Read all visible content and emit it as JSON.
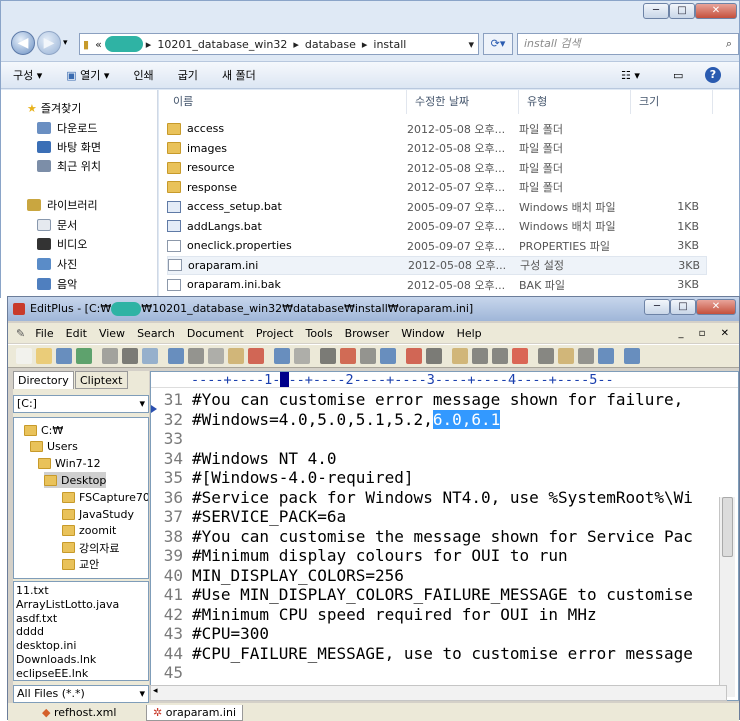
{
  "explorer": {
    "window_controls": [
      "─",
      "□",
      "✕"
    ],
    "address": {
      "back_icon": "back-arrow",
      "forward_icon": "forward-arrow",
      "prefix": "«",
      "segments": [
        "10201_database_win32",
        "database",
        "install"
      ],
      "separator": "▸"
    },
    "search": {
      "placeholder": "install 검색"
    },
    "toolbar": {
      "organize": "구성 ▾",
      "open": "열기 ▾",
      "print": "인쇄",
      "burn": "굽기",
      "new_folder": "새 폴더"
    },
    "nav": {
      "favorites": "즐겨찾기",
      "favorites_items": [
        "다운로드",
        "바탕 화면",
        "최근 위치"
      ],
      "libraries": "라이브러리",
      "library_items": [
        "문서",
        "비디오",
        "사진",
        "음악"
      ]
    },
    "columns": {
      "name": "이름",
      "modified": "수정한 날짜",
      "type": "유형",
      "size": "크기"
    },
    "files": [
      {
        "name": "access",
        "date": "2012-05-08 오후...",
        "type": "파일 폴더",
        "size": "",
        "kind": "folder"
      },
      {
        "name": "images",
        "date": "2012-05-08 오후...",
        "type": "파일 폴더",
        "size": "",
        "kind": "folder"
      },
      {
        "name": "resource",
        "date": "2012-05-08 오후...",
        "type": "파일 폴더",
        "size": "",
        "kind": "folder"
      },
      {
        "name": "response",
        "date": "2012-05-07 오후...",
        "type": "파일 폴더",
        "size": "",
        "kind": "folder"
      },
      {
        "name": "access_setup.bat",
        "date": "2005-09-07 오후...",
        "type": "Windows 배치 파일",
        "size": "1KB",
        "kind": "bat"
      },
      {
        "name": "addLangs.bat",
        "date": "2005-09-07 오후...",
        "type": "Windows 배치 파일",
        "size": "1KB",
        "kind": "bat"
      },
      {
        "name": "oneclick.properties",
        "date": "2005-09-07 오후...",
        "type": "PROPERTIES 파일",
        "size": "3KB",
        "kind": "doc"
      },
      {
        "name": "oraparam.ini",
        "date": "2012-05-08 오후...",
        "type": "구성 설정",
        "size": "3KB",
        "kind": "doc"
      },
      {
        "name": "oraparam.ini.bak",
        "date": "2012-05-08 오후...",
        "type": "BAK 파일",
        "size": "3KB",
        "kind": "doc"
      }
    ]
  },
  "editplus": {
    "title_prefix": "EditPlus - [C:₩",
    "title_suffix": "₩10201_database_win32₩database₩install₩oraparam.ini]",
    "menu": [
      "File",
      "Edit",
      "View",
      "Search",
      "Document",
      "Project",
      "Tools",
      "Browser",
      "Window",
      "Help"
    ],
    "side_tabs": {
      "directory": "Directory",
      "cliptext": "Cliptext"
    },
    "drive": "[C:]",
    "dir_tree": [
      "C:₩",
      "Users",
      "Win7-12",
      "Desktop",
      "FSCapture70",
      "JavaStudy",
      "zoomit",
      "강의자료",
      "교안"
    ],
    "file_list": [
      "11.txt",
      "ArrayListLotto.java",
      "asdf.txt",
      "dddd",
      "desktop.ini",
      "Downloads.lnk",
      "eclipseEE.lnk"
    ],
    "filter": "All Files (*.*)",
    "ruler": "----+----1----+----2----+----3----+----4----+----5--",
    "lines": [
      {
        "n": "31",
        "text": "#You can customise error message shown for failure, "
      },
      {
        "n": "32",
        "text": "#Windows=4.0,5.0,5.1,5.2,",
        "selected": "6.0,6.1"
      },
      {
        "n": "33",
        "text": ""
      },
      {
        "n": "34",
        "text": "#Windows NT 4.0"
      },
      {
        "n": "35",
        "text": "#[Windows-4.0-required]"
      },
      {
        "n": "36",
        "text": "#Service pack for Windows NT4.0, use %SystemRoot%\\Wi"
      },
      {
        "n": "37",
        "text": "#SERVICE_PACK=6a"
      },
      {
        "n": "38",
        "text": "#You can customise the message shown for Service Pac"
      },
      {
        "n": "39",
        "text": "#Minimum display colours for OUI to run"
      },
      {
        "n": "40",
        "text": "MIN_DISPLAY_COLORS=256"
      },
      {
        "n": "41",
        "text": "#Use MIN_DISPLAY_COLORS_FAILURE_MESSAGE to customise"
      },
      {
        "n": "42",
        "text": "#Minimum CPU speed required for OUI in MHz"
      },
      {
        "n": "43",
        "text": "#CPU=300"
      },
      {
        "n": "44",
        "text": "#CPU_FAILURE_MESSAGE, use to customise error message"
      },
      {
        "n": "45",
        "text": ""
      }
    ],
    "doc_tabs": [
      "refhost.xml",
      "oraparam.ini"
    ]
  }
}
